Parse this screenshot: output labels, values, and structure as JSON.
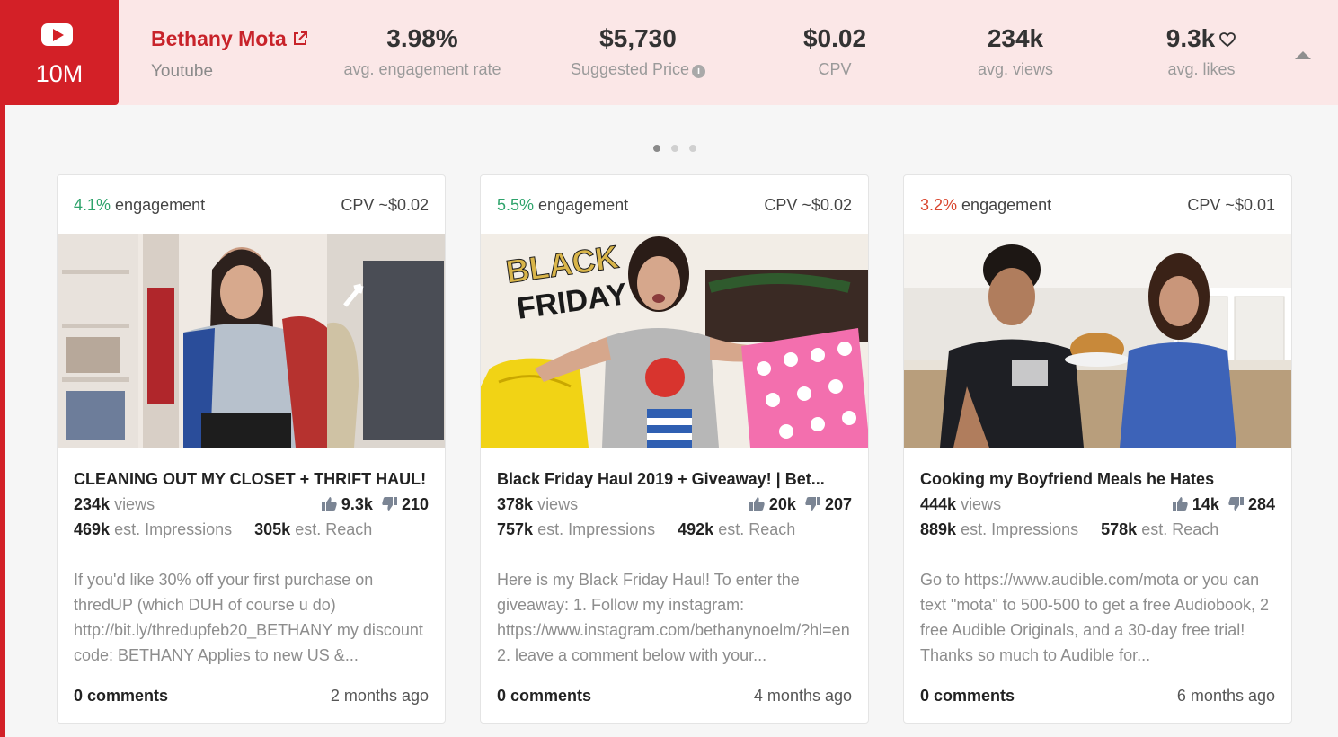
{
  "header": {
    "platform_icon": "youtube-icon",
    "subscribers": "10M",
    "channel_name": "Bethany Mota",
    "channel_platform": "Youtube",
    "stats": [
      {
        "value": "3.98%",
        "label": "avg. engagement rate"
      },
      {
        "value": "$5,730",
        "label": "Suggested Price"
      },
      {
        "value": "$0.02",
        "label": "CPV"
      },
      {
        "value": "234k",
        "label": "avg. views"
      },
      {
        "value": "9.3k",
        "label": "avg. likes"
      }
    ],
    "accent_color": "#d32027"
  },
  "carousel": {
    "pages": 3,
    "active_page": 1
  },
  "cards": [
    {
      "engagement_pct": "4.1%",
      "engagement_label": "engagement",
      "cpv": "CPV ~$0.02",
      "title": "CLEANING OUT MY CLOSET + THRIFT HAUL!",
      "views": "234k",
      "views_label": "views",
      "likes": "9.3k",
      "dislikes": "210",
      "impressions": "469k",
      "impressions_label": "est. Impressions",
      "reach": "305k",
      "reach_label": "est. Reach",
      "description": "If you'd like 30% off your first purchase on thredUP (which DUH of course u do) http://bit.ly/thredupfeb20_BETHANY my discount code: BETHANY Applies to new US &...",
      "comments": "0 comments",
      "age": "2 months ago"
    },
    {
      "engagement_pct": "5.5%",
      "engagement_label": "engagement",
      "cpv": "CPV ~$0.02",
      "title": "Black Friday Haul 2019 + Giveaway! | Bet...",
      "views": "378k",
      "views_label": "views",
      "likes": "20k",
      "dislikes": "207",
      "impressions": "757k",
      "impressions_label": "est. Impressions",
      "reach": "492k",
      "reach_label": "est. Reach",
      "description": "Here is my Black Friday Haul! To enter the giveaway: 1. Follow my instagram: https://www.instagram.com/bethanynoelm/?hl=en 2. leave a comment below with your...",
      "comments": "0 comments",
      "age": "4 months ago",
      "thumb_text": [
        "BLACK",
        "FRIDAY"
      ]
    },
    {
      "engagement_pct": "3.2%",
      "engagement_label": "engagement",
      "cpv": "CPV ~$0.01",
      "title": "Cooking my Boyfriend Meals he Hates",
      "views": "444k",
      "views_label": "views",
      "likes": "14k",
      "dislikes": "284",
      "impressions": "889k",
      "impressions_label": "est. Impressions",
      "reach": "578k",
      "reach_label": "est. Reach",
      "description": "Go to https://www.audible.com/mota or you can text \"mota\" to 500-500 to get a free Audiobook, 2 free Audible Originals, and a 30-day free trial! Thanks so much to Audible for...",
      "comments": "0 comments",
      "age": "6 months ago"
    }
  ]
}
